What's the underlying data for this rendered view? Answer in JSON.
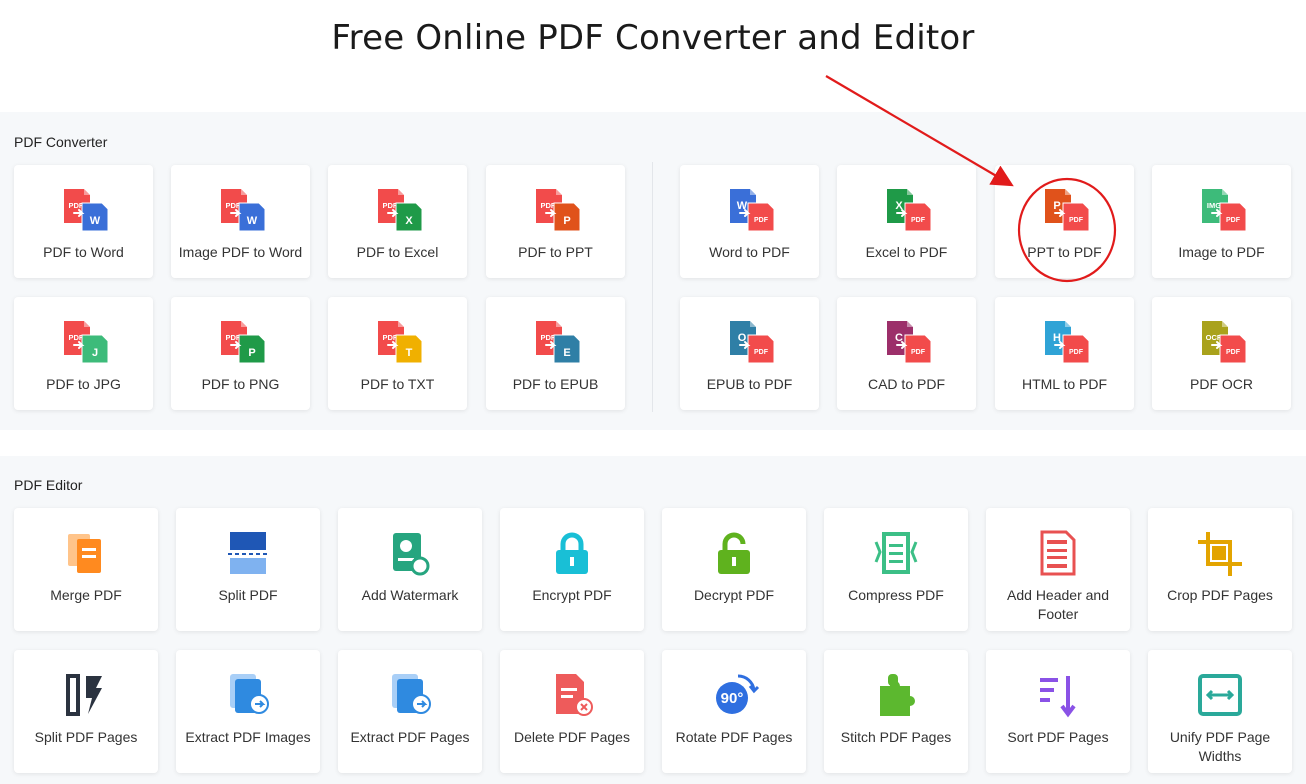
{
  "title": "Free Online PDF Converter and Editor",
  "converter": {
    "label": "PDF Converter",
    "items": [
      {
        "label": "PDF to Word",
        "icon": "pdf-to-word-icon",
        "src": "PDF",
        "dst": "W",
        "color": "#3a6fd8"
      },
      {
        "label": "Image PDF to Word",
        "icon": "image-pdf-to-word-icon",
        "src": "PDF",
        "dst": "W",
        "color": "#3a6fd8"
      },
      {
        "label": "PDF to Excel",
        "icon": "pdf-to-excel-icon",
        "src": "PDF",
        "dst": "X",
        "color": "#1f9a48"
      },
      {
        "label": "PDF to PPT",
        "icon": "pdf-to-ppt-icon",
        "src": "PDF",
        "dst": "P",
        "color": "#e0521b"
      },
      {
        "label": "Word to PDF",
        "icon": "word-to-pdf-icon",
        "src": "W",
        "dst": "PDF",
        "color": "#3a6fd8"
      },
      {
        "label": "Excel to PDF",
        "icon": "excel-to-pdf-icon",
        "src": "X",
        "dst": "PDF",
        "color": "#1f9a48"
      },
      {
        "label": "PPT to PDF",
        "icon": "ppt-to-pdf-icon",
        "src": "P",
        "dst": "PDF",
        "color": "#e0521b"
      },
      {
        "label": "Image to PDF",
        "icon": "image-to-pdf-icon",
        "src": "IMG",
        "dst": "PDF",
        "color": "#3dbb7a"
      },
      {
        "label": "PDF to JPG",
        "icon": "pdf-to-jpg-icon",
        "src": "PDF",
        "dst": "J",
        "color": "#3dbb7a"
      },
      {
        "label": "PDF to PNG",
        "icon": "pdf-to-png-icon",
        "src": "PDF",
        "dst": "P",
        "color": "#1f9a48"
      },
      {
        "label": "PDF to TXT",
        "icon": "pdf-to-txt-icon",
        "src": "PDF",
        "dst": "T",
        "color": "#f0b000"
      },
      {
        "label": "PDF to EPUB",
        "icon": "pdf-to-epub-icon",
        "src": "PDF",
        "dst": "E",
        "color": "#2f7fa6"
      },
      {
        "label": "EPUB to PDF",
        "icon": "epub-to-pdf-icon",
        "src": "O",
        "dst": "PDF",
        "color": "#2f7fa6"
      },
      {
        "label": "CAD to PDF",
        "icon": "cad-to-pdf-icon",
        "src": "C",
        "dst": "PDF",
        "color": "#9c2f6a"
      },
      {
        "label": "HTML to PDF",
        "icon": "html-to-pdf-icon",
        "src": "H",
        "dst": "PDF",
        "color": "#2fa3d6"
      },
      {
        "label": "PDF OCR",
        "icon": "pdf-ocr-icon",
        "src": "OCR",
        "dst": "PDF",
        "color": "#a9a21c"
      }
    ]
  },
  "editor": {
    "label": "PDF Editor",
    "items": [
      {
        "label": "Merge PDF",
        "icon": "merge-pdf-icon",
        "color": "#ff8a1f"
      },
      {
        "label": "Split PDF",
        "icon": "split-pdf-icon",
        "color": "#1f57b5"
      },
      {
        "label": "Add Watermark",
        "icon": "add-watermark-icon",
        "color": "#26a57f"
      },
      {
        "label": "Encrypt PDF",
        "icon": "encrypt-pdf-icon",
        "color": "#19bfd6"
      },
      {
        "label": "Decrypt PDF",
        "icon": "decrypt-pdf-icon",
        "color": "#5fb21e"
      },
      {
        "label": "Compress PDF",
        "icon": "compress-pdf-icon",
        "color": "#3cbf86"
      },
      {
        "label": "Add Header and Footer",
        "icon": "header-footer-icon",
        "color": "#e85151"
      },
      {
        "label": "Crop PDF Pages",
        "icon": "crop-pdf-icon",
        "color": "#e3a400"
      },
      {
        "label": "Split PDF Pages",
        "icon": "split-pdf-pages-icon",
        "color": "#2b3340"
      },
      {
        "label": "Extract PDF Images",
        "icon": "extract-images-icon",
        "color": "#2f8ae0"
      },
      {
        "label": "Extract PDF Pages",
        "icon": "extract-pages-icon",
        "color": "#2f8ae0"
      },
      {
        "label": "Delete PDF Pages",
        "icon": "delete-pages-icon",
        "color": "#ee5b5b"
      },
      {
        "label": "Rotate PDF Pages",
        "icon": "rotate-pages-icon",
        "color": "#2f6fe0"
      },
      {
        "label": "Stitch PDF Pages",
        "icon": "stitch-pages-icon",
        "color": "#5cb82f"
      },
      {
        "label": "Sort PDF Pages",
        "icon": "sort-pages-icon",
        "color": "#8a52e6"
      },
      {
        "label": "Unify PDF Page Widths",
        "icon": "unify-widths-icon",
        "color": "#2aa99a"
      }
    ]
  },
  "annotation": {
    "color": "#e11b1b",
    "target": "PPT to PDF"
  }
}
